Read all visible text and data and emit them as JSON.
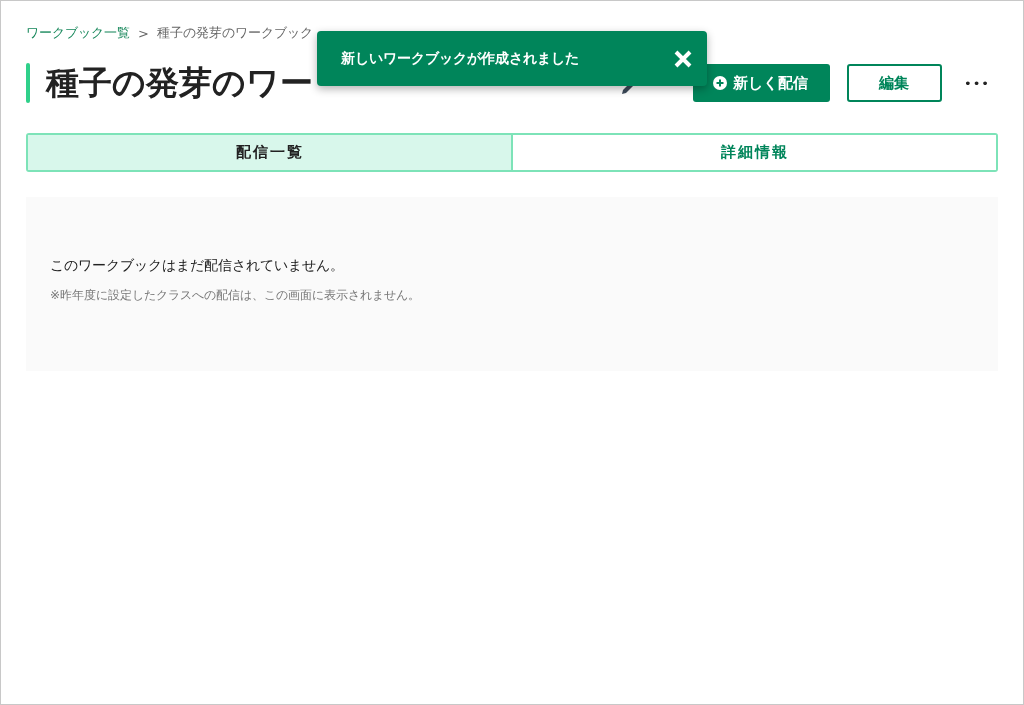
{
  "breadcrumb": {
    "link": "ワークブック一覧",
    "separator": ">",
    "current": "種子の発芽のワークブック"
  },
  "title": "種子の発芽のワー",
  "actions": {
    "primary": "新しく配信",
    "secondary": "編集",
    "more": "•••"
  },
  "tabs": [
    {
      "label": "配信一覧",
      "selected": true
    },
    {
      "label": "詳細情報",
      "selected": false
    }
  ],
  "empty_state": {
    "message": "このワークブックはまだ配信されていません。",
    "note": "※昨年度に設定したクラスへの配信は、この画面に表示されません。"
  },
  "toast": {
    "message": "新しいワークブックが作成されました"
  }
}
